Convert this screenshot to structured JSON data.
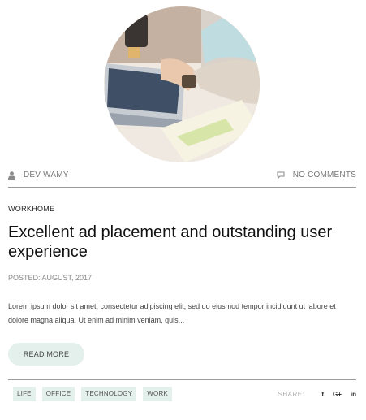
{
  "post": {
    "author": "DEV WAMY",
    "comments": "NO COMMENTS",
    "category": "WORKHOME",
    "title": "Excellent ad placement and outstanding user experience",
    "posted": "POSTED: AUGUST, 2017",
    "excerpt": "Lorem ipsum dolor sit amet, consectetur adipiscing elit, sed do eiusmod tempor incididunt ut labore et dolore magna aliqua. Ut enim ad minim veniam, quis...",
    "read_more_label": "READ MORE"
  },
  "tags": [
    "LIFE",
    "OFFICE",
    "TECHNOLOGY",
    "WORK"
  ],
  "share": {
    "label": "SHARE:",
    "facebook": "f",
    "googleplus": "G+",
    "linkedin": "in"
  },
  "colors": {
    "accent_bg": "#e4f0ec",
    "rule": "#9a9a9a"
  },
  "icons": [
    "user-icon",
    "comment-icon",
    "facebook-icon",
    "google-plus-icon",
    "linkedin-icon"
  ]
}
